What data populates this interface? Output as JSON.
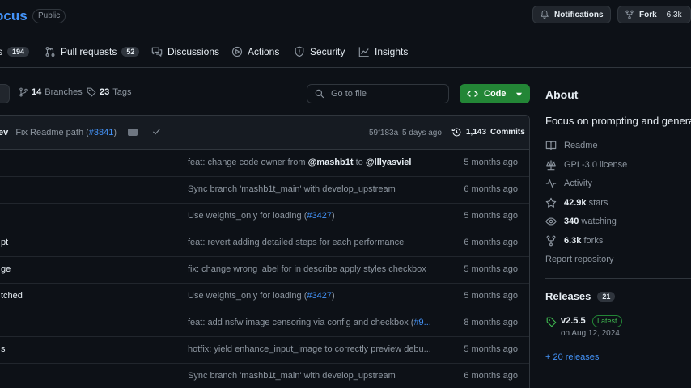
{
  "repo": {
    "name": "ocus",
    "visibility": "Public"
  },
  "header_actions": {
    "notifications_label": "Notifications",
    "fork_label": "Fork",
    "fork_count": "6.3k"
  },
  "tabs": [
    {
      "label": "s",
      "count": "194",
      "icon": "issues-icon"
    },
    {
      "label": "Pull requests",
      "count": "52",
      "icon": "pull-request-icon"
    },
    {
      "label": "Discussions",
      "count": "",
      "icon": "discussions-icon"
    },
    {
      "label": "Actions",
      "count": "",
      "icon": "actions-icon"
    },
    {
      "label": "Security",
      "count": "",
      "icon": "shield-icon"
    },
    {
      "label": "Insights",
      "count": "",
      "icon": "graph-icon"
    }
  ],
  "branch_bar": {
    "branches_count": "14",
    "branches_label": "Branches",
    "tags_count": "23",
    "tags_label": "Tags",
    "goto_placeholder": "Go to file",
    "code_label": "Code"
  },
  "latest_commit": {
    "author_fragment": "ev",
    "message": "Fix Readme path (",
    "ref": "#3841",
    "message_end": ")",
    "hash": "59f183a",
    "time": "5 days ago",
    "commits_count": "1,143",
    "commits_label": "Commits"
  },
  "files": [
    {
      "name": "",
      "message_parts": [
        {
          "t": "feat: change code owner from ",
          "s": "plain"
        },
        {
          "t": "@mashb1t",
          "s": "bold"
        },
        {
          "t": " to ",
          "s": "plain"
        },
        {
          "t": "@lllyasviel",
          "s": "bold"
        }
      ],
      "when": "5 months ago"
    },
    {
      "name": "",
      "message_parts": [
        {
          "t": "Sync branch 'mashb1t_main' with develop_upstream",
          "s": "plain"
        }
      ],
      "when": "6 months ago"
    },
    {
      "name": "",
      "message_parts": [
        {
          "t": "Use weights_only for loading (",
          "s": "plain"
        },
        {
          "t": "#3427",
          "s": "ref"
        },
        {
          "t": ")",
          "s": "plain"
        }
      ],
      "when": "5 months ago"
    },
    {
      "name": "pt",
      "message_parts": [
        {
          "t": "feat: revert adding detailed steps for each performance",
          "s": "plain"
        }
      ],
      "when": "6 months ago"
    },
    {
      "name": "ge",
      "message_parts": [
        {
          "t": "fix: change wrong label for in describe apply styles checkbox",
          "s": "plain"
        }
      ],
      "when": "5 months ago"
    },
    {
      "name": "tched",
      "message_parts": [
        {
          "t": "Use weights_only for loading (",
          "s": "plain"
        },
        {
          "t": "#3427",
          "s": "ref"
        },
        {
          "t": ")",
          "s": "plain"
        }
      ],
      "when": "5 months ago"
    },
    {
      "name": "",
      "message_parts": [
        {
          "t": "feat: add nsfw image censoring via config and checkbox (",
          "s": "plain"
        },
        {
          "t": "#9...",
          "s": "ref"
        }
      ],
      "when": "8 months ago"
    },
    {
      "name": "s",
      "message_parts": [
        {
          "t": "hotfix: yield enhance_input_image to correctly preview debu...",
          "s": "plain"
        }
      ],
      "when": "5 months ago"
    },
    {
      "name": "",
      "message_parts": [
        {
          "t": "Sync branch 'mashb1t_main' with develop_upstream",
          "s": "plain"
        }
      ],
      "when": "6 months ago"
    }
  ],
  "about": {
    "heading": "About",
    "description": "Focus on prompting and genera",
    "readme": "Readme",
    "license": "GPL-3.0 license",
    "activity": "Activity",
    "stars_count": "42.9k",
    "stars_label": "stars",
    "watching_count": "340",
    "watching_label": "watching",
    "forks_count": "6.3k",
    "forks_label": "forks",
    "report": "Report repository"
  },
  "releases": {
    "heading": "Releases",
    "count": "21",
    "version": "v2.5.5",
    "latest_badge": "Latest",
    "date": "on Aug 12, 2024",
    "more": "+ 20 releases"
  },
  "colors": {
    "background": "#0d1117",
    "accent_link": "#4493f8",
    "code_button": "#238636",
    "latest_badge": "#3fb950"
  }
}
